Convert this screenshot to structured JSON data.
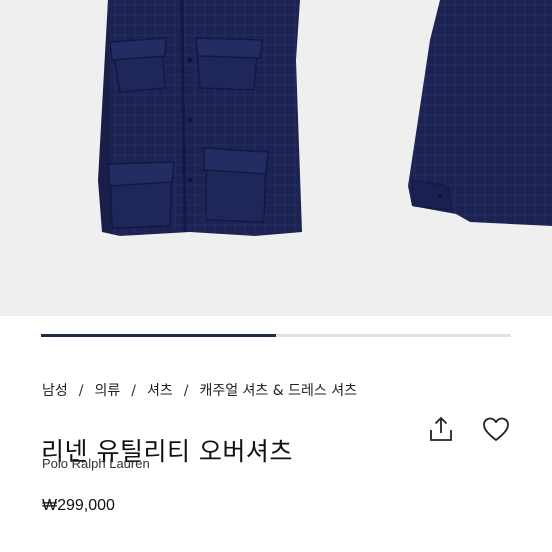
{
  "product_gallery": {
    "image_alt": "Navy linen utility overshirt jacket, front and back views",
    "progress_fraction": 0.5
  },
  "breadcrumb": {
    "items": [
      "남성",
      "의류",
      "셔츠",
      "캐주얼 셔츠 & 드레스 셔츠"
    ],
    "separator": "/"
  },
  "product": {
    "title": "리넨 유틸리티 오버셔츠",
    "brand": "Polo Ralph Lauren",
    "price": "₩299,000"
  },
  "icons": {
    "share": "share-icon",
    "wishlist": "heart-icon"
  },
  "colors": {
    "garment": "#1c2352",
    "progress": "#1f2b4a",
    "background": "#efefef"
  }
}
